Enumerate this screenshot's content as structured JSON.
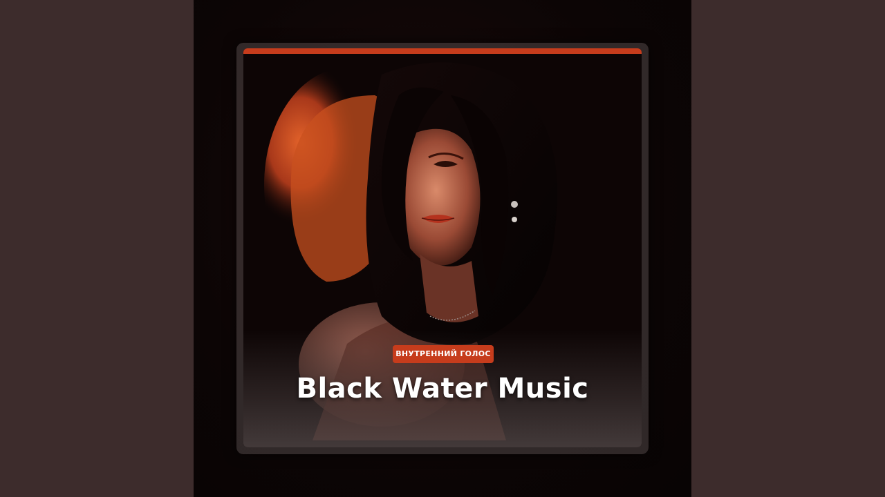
{
  "cover": {
    "badge_text": "ВНУТРЕННИЙ ГОЛОС",
    "title": "Black Water Music",
    "accent_color": "#c63c1c",
    "background_color": "#3d2c2c"
  }
}
